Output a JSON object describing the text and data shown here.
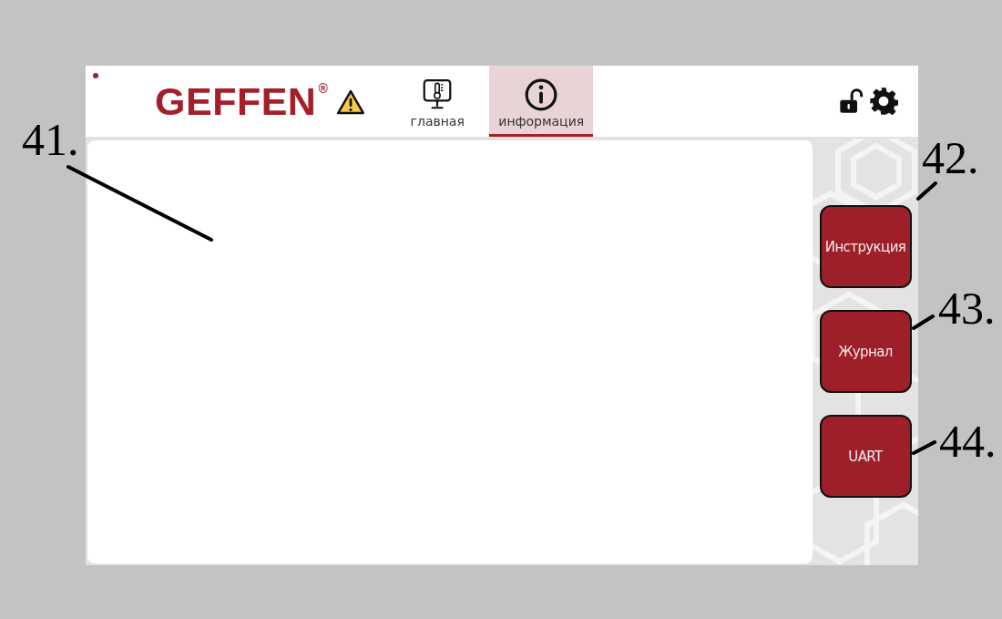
{
  "header": {
    "status_dot": {
      "color": "#a51f2a"
    },
    "logo": {
      "text": "GEFFEN",
      "mark": "®"
    },
    "warning": true,
    "tabs": [
      {
        "label": "главная",
        "kind": "home",
        "selected": false
      },
      {
        "label": "информация",
        "kind": "info",
        "selected": true
      }
    ],
    "locked": false
  },
  "side_buttons": [
    "Инструкция",
    "Журнал",
    "UART"
  ],
  "annotations": [
    "41.",
    "42.",
    "43.",
    "44."
  ]
}
